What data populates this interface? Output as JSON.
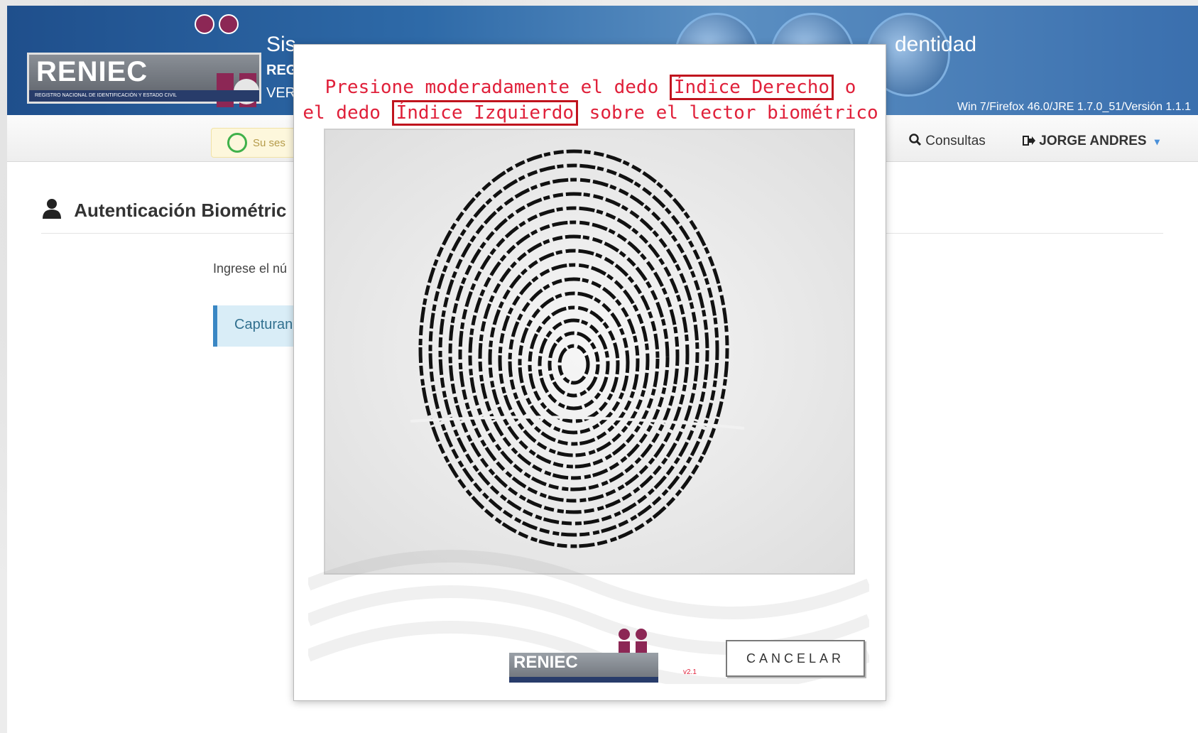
{
  "header": {
    "logo_text": "RENIEC",
    "logo_subtext": "REGISTRO NACIONAL DE IDENTIFICACIÓN Y ESTADO CIVIL",
    "title_start": "Sis",
    "title_end": "dentidad",
    "sub1": "REG",
    "sub2": "VER",
    "version_info": "Win 7/Firefox 46.0/JRE 1.7.0_51/Versión 1.1.1"
  },
  "navbar": {
    "session_text": "Su ses",
    "consultas_label": "Consultas",
    "user_label": "JORGE ANDRES"
  },
  "page": {
    "title": "Autenticación Biométric",
    "ingrese_text": "Ingrese el nú",
    "capturando_text": "Capturand"
  },
  "modal": {
    "instruction": {
      "line1_pre": "Presione moderadamente el dedo ",
      "line1_hl": "Índice Derecho",
      "line1_post": " o",
      "line2_pre": "el dedo ",
      "line2_hl": "Índice Izquierdo",
      "line2_post": " sobre el lector biométrico"
    },
    "logo_text": "RENIEC",
    "version": "v2.1",
    "cancel_label": "CANCELAR"
  },
  "colors": {
    "header_blue": "#2e6aa8",
    "instruction_red": "#e0203a",
    "highlight_border": "#c0141e",
    "session_green": "#3fb14a"
  }
}
